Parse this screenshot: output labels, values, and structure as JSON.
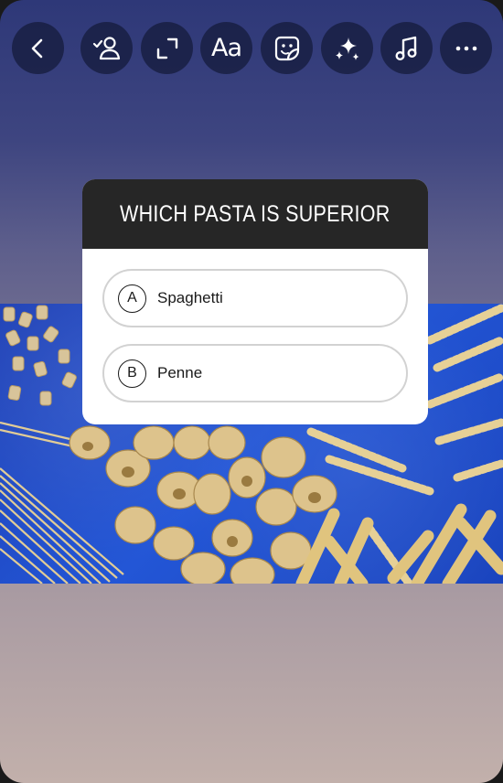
{
  "toolbar": {
    "buttons": [
      {
        "name": "back",
        "icon": "chevron-left-icon"
      },
      {
        "name": "mention",
        "icon": "person-check-icon"
      },
      {
        "name": "resize",
        "icon": "expand-icon"
      },
      {
        "name": "text",
        "icon": "text-aa-icon",
        "label": "Aa"
      },
      {
        "name": "sticker",
        "icon": "sticker-icon"
      },
      {
        "name": "effects",
        "icon": "sparkles-icon"
      },
      {
        "name": "music",
        "icon": "music-note-icon"
      },
      {
        "name": "more",
        "icon": "more-horizontal-icon"
      }
    ]
  },
  "poll": {
    "title": "WHICH PASTA IS SUPERIOR",
    "options": [
      {
        "letter": "A",
        "text": "Spaghetti"
      },
      {
        "letter": "B",
        "text": "Penne"
      }
    ]
  },
  "colors": {
    "toolbar_button_bg": "#161c3e",
    "poll_header_bg": "#262626",
    "photo_background": "#1b48c9"
  }
}
